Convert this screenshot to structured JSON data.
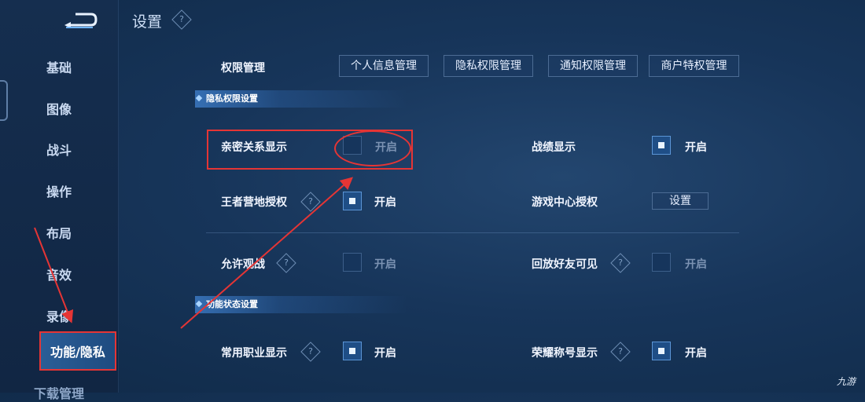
{
  "header": {
    "title": "设置",
    "help_glyph": "?"
  },
  "sidebar": {
    "items": [
      {
        "label": "基础"
      },
      {
        "label": "图像"
      },
      {
        "label": "战斗"
      },
      {
        "label": "操作"
      },
      {
        "label": "布局"
      },
      {
        "label": "音效"
      },
      {
        "label": "录像"
      },
      {
        "label": "功能/隐私",
        "active": true
      },
      {
        "label": "下载管理"
      }
    ]
  },
  "permissions": {
    "label": "权限管理",
    "tabs": [
      "个人信息管理",
      "隐私权限管理",
      "通知权限管理",
      "商户特权管理"
    ]
  },
  "privacy_section": {
    "title": "隐私权限设置",
    "settings": [
      {
        "label": "亲密关系显示",
        "state_label": "开启",
        "checked": false
      },
      {
        "label": "战绩显示",
        "state_label": "开启",
        "checked": true
      },
      {
        "label": "王者营地授权",
        "state_label": "开启",
        "checked": true,
        "help": true
      },
      {
        "label": "游戏中心授权",
        "button_label": "设置"
      },
      {
        "label": "允许观战",
        "state_label": "开启",
        "checked": false,
        "help": true
      },
      {
        "label": "回放好友可见",
        "state_label": "开启",
        "checked": false,
        "help": true
      }
    ]
  },
  "function_section": {
    "title": "功能状态设置",
    "settings": [
      {
        "label": "常用职业显示",
        "state_label": "开启",
        "checked": true,
        "help": true
      },
      {
        "label": "荣耀称号显示",
        "state_label": "开启",
        "checked": true,
        "help": true
      }
    ]
  },
  "watermark": "九游",
  "colors": {
    "accent": "#5b95d6",
    "annotation": "#e53535",
    "background": "#17355a"
  }
}
